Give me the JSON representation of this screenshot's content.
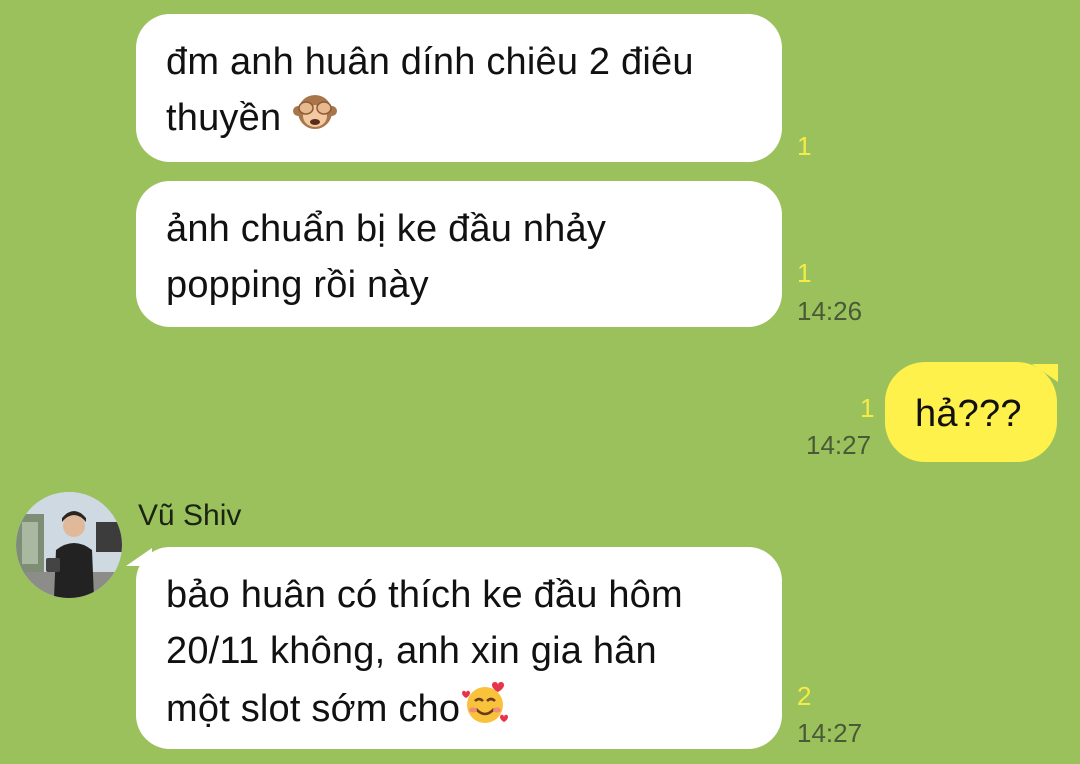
{
  "messages": [
    {
      "id": "m1",
      "direction": "incoming",
      "lines": [
        "đm anh huân dính chiêu 2 điêu",
        "thuyền"
      ],
      "trailing_emoji": "see-no-evil-monkey-icon",
      "unread": "1",
      "time": ""
    },
    {
      "id": "m2",
      "direction": "incoming",
      "lines": [
        "ảnh chuẩn bị ke đầu nhảy",
        "popping rồi này"
      ],
      "unread": "1",
      "time": "14:26"
    },
    {
      "id": "m3",
      "direction": "outgoing",
      "lines": [
        "hả???"
      ],
      "unread": "1",
      "time": "14:27"
    },
    {
      "id": "m4",
      "direction": "incoming",
      "sender": "Vũ Shiv",
      "lines": [
        "bảo huân có thích ke đầu hôm",
        "20/11 không, anh xin gia hân",
        "một slot sớm cho"
      ],
      "trailing_emoji": "smiling-face-with-hearts-icon",
      "unread": "2",
      "time": "14:27"
    }
  ],
  "colors": {
    "chat_background": "#9bc15d",
    "incoming_bubble": "#ffffff",
    "outgoing_bubble": "#fef14c",
    "unread_count": "#f5ec47",
    "timestamp": "#4a5a36"
  }
}
